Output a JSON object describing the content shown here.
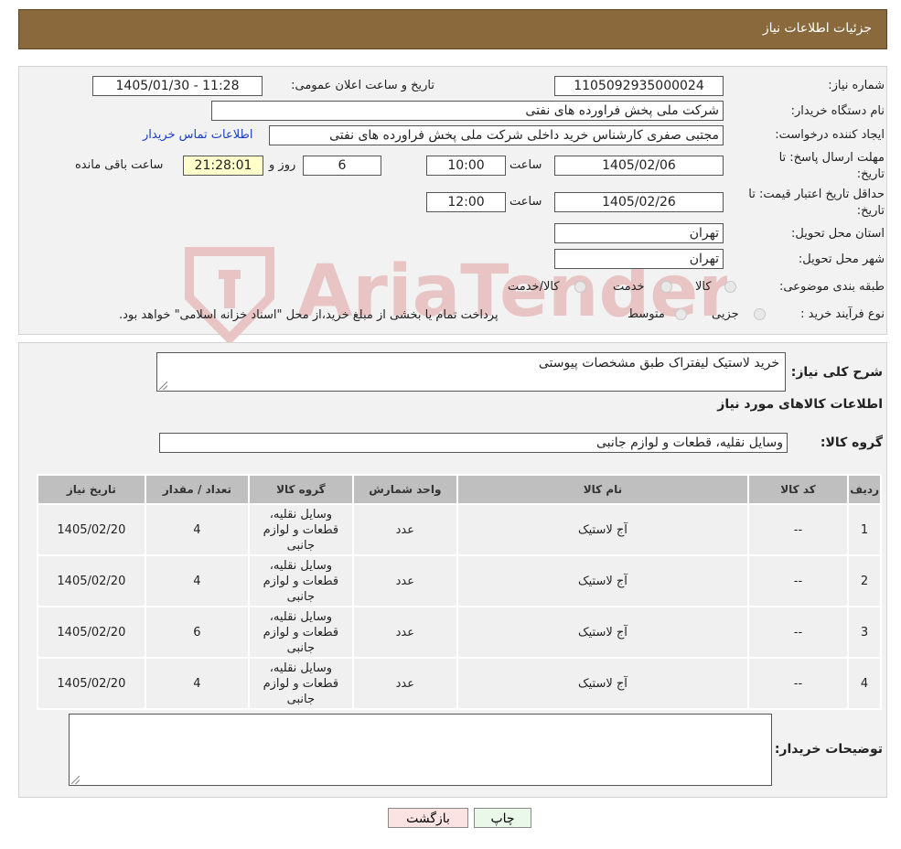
{
  "header": {
    "title": "جزئیات اطلاعات نیاز"
  },
  "form": {
    "need_number_label": "شماره نیاز:",
    "need_number": "1105092935000024",
    "announce_label": "تاریخ و ساعت اعلان عمومی:",
    "announce_value": "1405/01/30 - 11:28",
    "buyer_org_label": "نام دستگاه خریدار:",
    "buyer_org": "شرکت ملی پخش فراورده های نفتی",
    "requester_label": "ایجاد کننده درخواست:",
    "requester": "مجتبی صفری کارشناس خرید داخلی شرکت ملی پخش فراورده های نفتی",
    "contact_link": "اطلاعات تماس خریدار",
    "deadline_label_1": "مهلت ارسال پاسخ: تا",
    "deadline_label_2": "تاریخ:",
    "deadline_date": "1405/02/06",
    "time_label": "ساعت",
    "deadline_time": "10:00",
    "days_value": "6",
    "days_label": "روز و",
    "remaining_time": "21:28:01",
    "remaining_label": "ساعت باقی مانده",
    "validity_label_1": "حداقل تاریخ اعتبار قیمت: تا",
    "validity_label_2": "تاریخ:",
    "validity_date": "1405/02/26",
    "validity_time": "12:00",
    "province_label": "استان محل تحویل:",
    "province": "تهران",
    "city_label": "شهر محل تحویل:",
    "city": "تهران",
    "category_label": "طبقه بندی موضوعی:",
    "category_options": [
      "کالا",
      "خدمت",
      "کالا/خدمت"
    ],
    "process_label": "نوع فرآیند خرید :",
    "process_options": [
      "جزیی",
      "متوسط"
    ],
    "process_note": "پرداخت تمام یا بخشی از مبلغ خرید،از محل \"اسناد خزانه اسلامی\" خواهد بود."
  },
  "details": {
    "desc_label": "شرح کلی نیاز:",
    "description": "خرید لاستیک لیفتراک طبق مشخصات پیوستی",
    "goods_info_title": "اطلاعات کالاهای مورد نیاز",
    "group_label": "گروه کالا:",
    "group_value": "وسایل نقلیه، قطعات و لوازم جانبی",
    "table": {
      "headers": [
        "ردیف",
        "کد کالا",
        "نام کالا",
        "واحد شمارش",
        "گروه کالا",
        "تعداد / مقدار",
        "تاریخ نیاز"
      ],
      "rows": [
        [
          "1",
          "--",
          "آج لاستیک",
          "عدد",
          "وسایل نقلیه، قطعات و لوازم جانبی",
          "4",
          "1405/02/20"
        ],
        [
          "2",
          "--",
          "آج لاستیک",
          "عدد",
          "وسایل نقلیه، قطعات و لوازم جانبی",
          "4",
          "1405/02/20"
        ],
        [
          "3",
          "--",
          "آج لاستیک",
          "عدد",
          "وسایل نقلیه، قطعات و لوازم جانبی",
          "6",
          "1405/02/20"
        ],
        [
          "4",
          "--",
          "آج لاستیک",
          "عدد",
          "وسایل نقلیه، قطعات و لوازم جانبی",
          "4",
          "1405/02/20"
        ]
      ]
    },
    "buyer_notes_label": "توضیحات خریدار:",
    "buyer_notes": ""
  },
  "buttons": {
    "print": "چاپ",
    "back": "بازگشت"
  },
  "watermark": {
    "text": "AriaTender.neT"
  },
  "colors": {
    "header_bg": "#8a6a3c",
    "link": "#1a3fc6",
    "watermark": "#e8c4c4"
  }
}
